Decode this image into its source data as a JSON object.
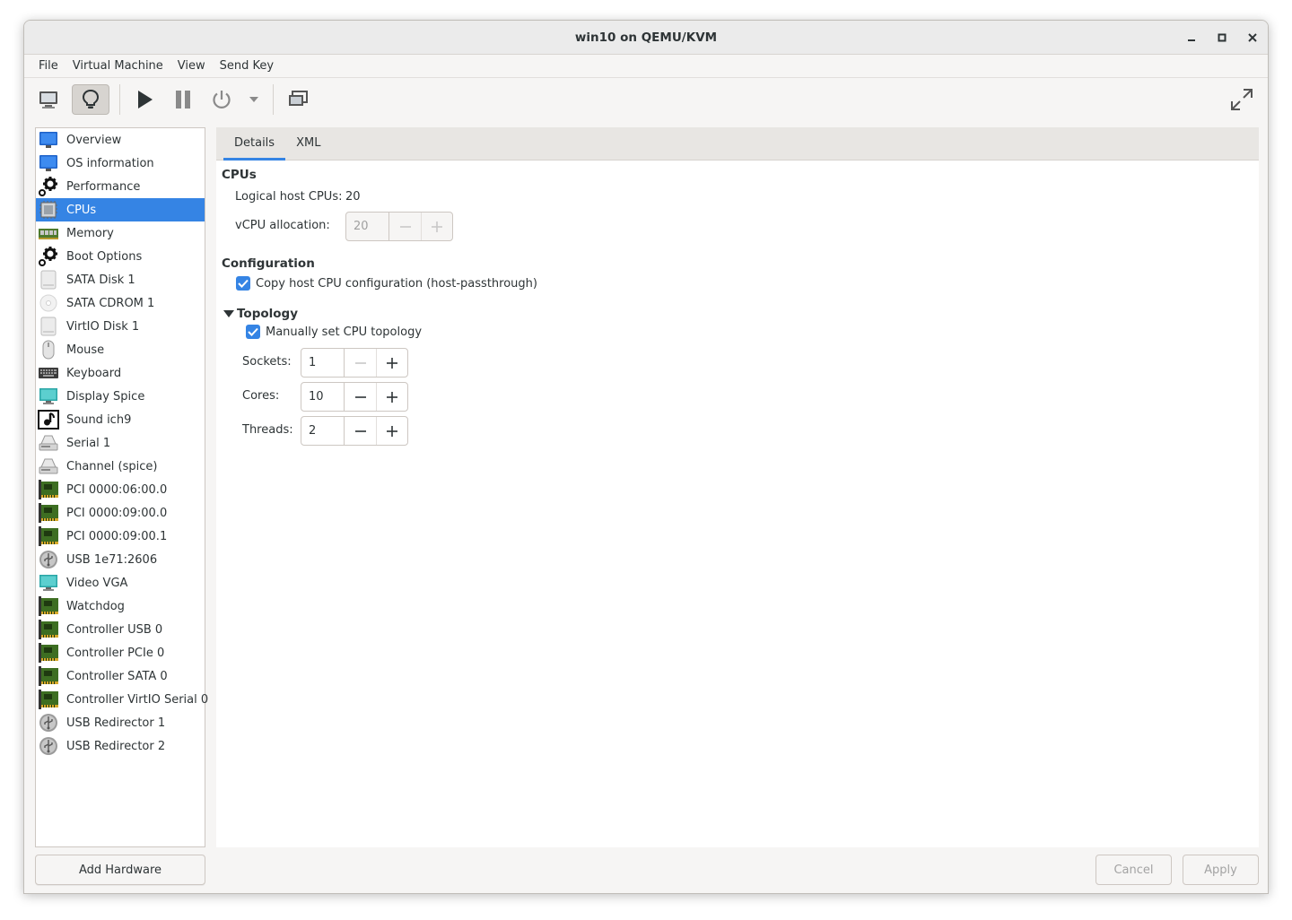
{
  "window": {
    "title": "win10 on QEMU/KVM"
  },
  "menubar": {
    "items": [
      "File",
      "Virtual Machine",
      "View",
      "Send Key"
    ]
  },
  "toolbar": {
    "icons": [
      "monitor-icon",
      "lightbulb-icon",
      "play-icon",
      "pause-icon",
      "power-icon",
      "dropdown-icon",
      "screenshot-icon",
      "fullscreen-icon"
    ]
  },
  "sidebar": {
    "selected": "CPUs",
    "items": [
      {
        "label": "Overview",
        "icon": "monitor-blue"
      },
      {
        "label": "OS information",
        "icon": "monitor-blue"
      },
      {
        "label": "Performance",
        "icon": "gear"
      },
      {
        "label": "CPUs",
        "icon": "chip"
      },
      {
        "label": "Memory",
        "icon": "memory"
      },
      {
        "label": "Boot Options",
        "icon": "gear"
      },
      {
        "label": "SATA Disk 1",
        "icon": "disk"
      },
      {
        "label": "SATA CDROM 1",
        "icon": "cdrom"
      },
      {
        "label": "VirtIO Disk 1",
        "icon": "disk"
      },
      {
        "label": "Mouse",
        "icon": "mouse"
      },
      {
        "label": "Keyboard",
        "icon": "keyboard"
      },
      {
        "label": "Display Spice",
        "icon": "display"
      },
      {
        "label": "Sound ich9",
        "icon": "sound"
      },
      {
        "label": "Serial 1",
        "icon": "serial"
      },
      {
        "label": "Channel (spice)",
        "icon": "serial"
      },
      {
        "label": "PCI 0000:06:00.0",
        "icon": "card"
      },
      {
        "label": "PCI 0000:09:00.0",
        "icon": "card"
      },
      {
        "label": "PCI 0000:09:00.1",
        "icon": "card"
      },
      {
        "label": "USB 1e71:2606",
        "icon": "usb"
      },
      {
        "label": "Video VGA",
        "icon": "display"
      },
      {
        "label": "Watchdog",
        "icon": "card"
      },
      {
        "label": "Controller USB 0",
        "icon": "card"
      },
      {
        "label": "Controller PCIe 0",
        "icon": "card"
      },
      {
        "label": "Controller SATA 0",
        "icon": "card"
      },
      {
        "label": "Controller VirtIO Serial 0",
        "icon": "card"
      },
      {
        "label": "USB Redirector 1",
        "icon": "usb"
      },
      {
        "label": "USB Redirector 2",
        "icon": "usb"
      }
    ],
    "add_button": "Add Hardware"
  },
  "tabs": [
    "Details",
    "XML"
  ],
  "cpus": {
    "section_title": "CPUs",
    "logical_label": "Logical host CPUs:",
    "logical_value": "20",
    "vcpu_label": "vCPU allocation:",
    "vcpu_value": "20"
  },
  "configuration": {
    "section_title": "Configuration",
    "copy_host_label": "Copy host CPU configuration (host-passthrough)",
    "copy_host_checked": true
  },
  "topology": {
    "section_title": "Topology",
    "manual_label": "Manually set CPU topology",
    "manual_checked": true,
    "sockets_label": "Sockets:",
    "sockets_value": "1",
    "cores_label": "Cores:",
    "cores_value": "10",
    "threads_label": "Threads:",
    "threads_value": "2"
  },
  "buttons": {
    "cancel": "Cancel",
    "apply": "Apply"
  },
  "colors": {
    "accent": "#3584e4",
    "window_bg": "#f6f5f4"
  }
}
